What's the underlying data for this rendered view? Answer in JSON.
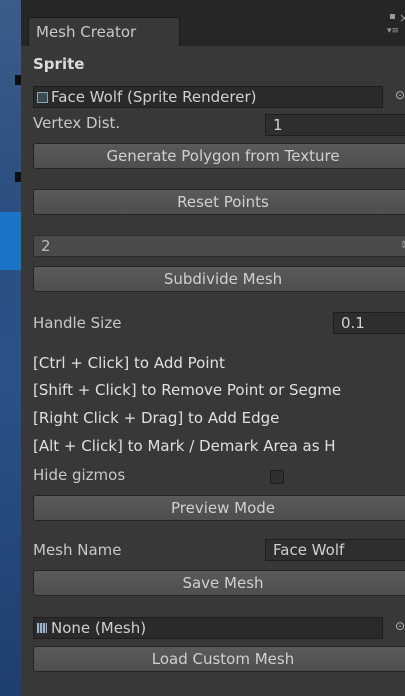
{
  "window": {
    "tab_title": "Mesh Creator"
  },
  "sprite": {
    "header": "Sprite",
    "object_field": "Face Wolf (Sprite Renderer)",
    "vertex_dist_label": "Vertex Dist.",
    "vertex_dist_value": "1",
    "generate_button": "Generate Polygon from Texture",
    "reset_button": "Reset Points",
    "subdivide_dropdown_value": "2",
    "subdivide_button": "Subdivide Mesh",
    "handle_size_label": "Handle Size",
    "handle_size_value": "0.1"
  },
  "instructions": [
    "[Ctrl + Click] to Add Point",
    "[Shift + Click] to Remove Point or Segme",
    "[Right Click + Drag] to Add Edge",
    "[Alt + Click] to Mark / Demark Area as H"
  ],
  "gizmos": {
    "label": "Hide gizmos",
    "checked": false
  },
  "preview_button": "Preview Mode",
  "mesh": {
    "name_label": "Mesh Name",
    "name_value": "Face Wolf",
    "save_button": "Save Mesh",
    "object_field": "None (Mesh)",
    "load_button": "Load Custom Mesh"
  },
  "icons": {
    "window_maximize": "square-icon",
    "window_menu": "menu-icon",
    "object_picker": "target-circle-icon",
    "sprite_renderer": "sprite-renderer-icon",
    "mesh": "mesh-icon",
    "dropdown": "updown-arrows-icon"
  },
  "colors": {
    "panel_bg": "#383838",
    "button_bg": "#545454",
    "field_bg": "#2a2a2a",
    "titlebar_bg": "#262626"
  }
}
